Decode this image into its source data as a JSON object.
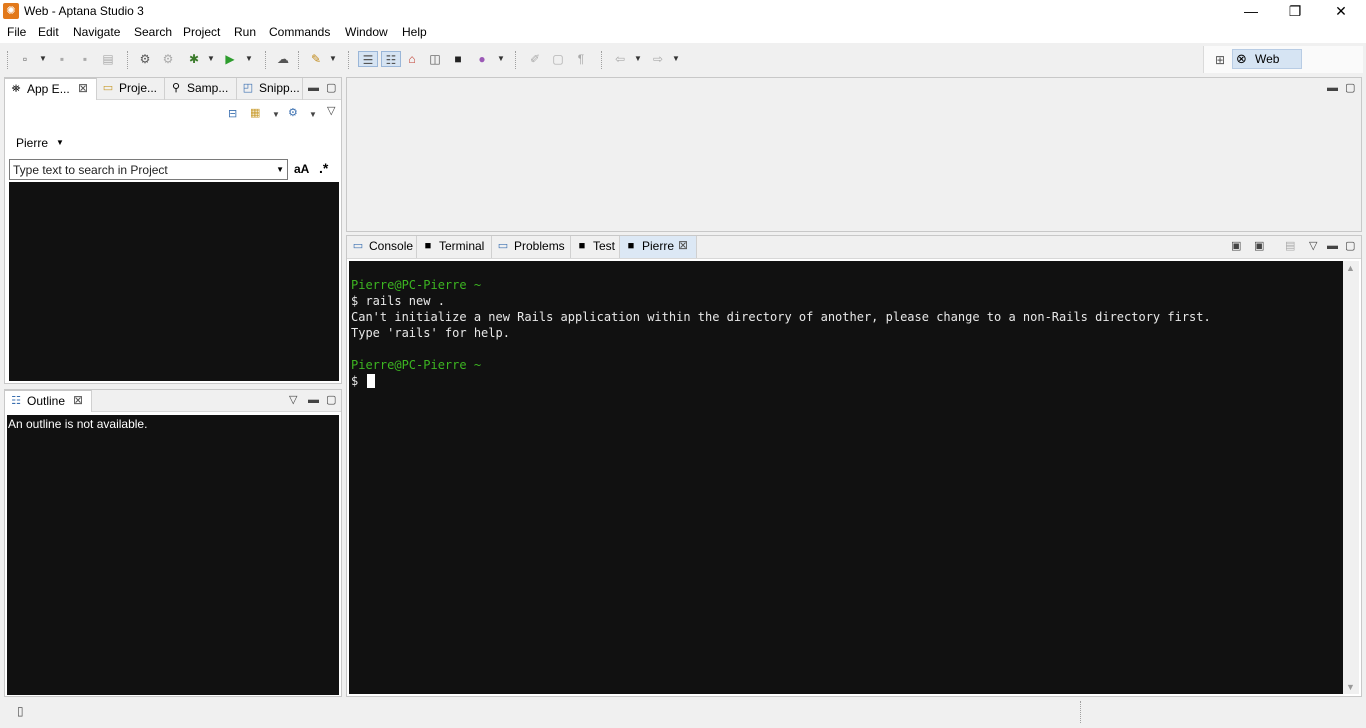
{
  "window": {
    "title": "Web - Aptana Studio 3",
    "minimize_glyph": "—",
    "maximize_glyph": "❐",
    "close_glyph": "✕"
  },
  "menu": [
    "File",
    "Edit",
    "Navigate",
    "Search",
    "Project",
    "Run",
    "Commands",
    "Window",
    "Help"
  ],
  "perspective": {
    "label": "Web"
  },
  "left_panel": {
    "tabs": [
      "App E...",
      "Proje...",
      "Samp...",
      "Snipp..."
    ],
    "project_label": "Pierre",
    "search_placeholder": "Type text to search in Project",
    "case_toggle": "aA",
    "regex_toggle": ".*"
  },
  "outline_panel": {
    "tab": "Outline",
    "message": "An outline is not available."
  },
  "bottom_panel": {
    "tabs": [
      "Console",
      "Terminal",
      "Problems",
      "Test",
      "Pierre"
    ]
  },
  "terminal": {
    "lines": [
      {
        "text": "Pierre@PC-Pierre ~",
        "color": "#3cb521"
      },
      {
        "text": "$ rails new .",
        "color": "#e8e8e8"
      },
      {
        "text": "Can't initialize a new Rails application within the directory of another, please change to a non-Rails directory first.",
        "color": "#e8e8e8"
      },
      {
        "text": "Type 'rails' for help.",
        "color": "#e8e8e8"
      },
      {
        "text": "",
        "color": "#e8e8e8"
      },
      {
        "text": "Pierre@PC-Pierre ~",
        "color": "#3cb521"
      },
      {
        "text": "$ ",
        "color": "#e8e8e8"
      }
    ]
  },
  "colors": {
    "accent": "#e2791b",
    "prompt_green": "#3cb521",
    "terminal_bg": "#111111"
  }
}
